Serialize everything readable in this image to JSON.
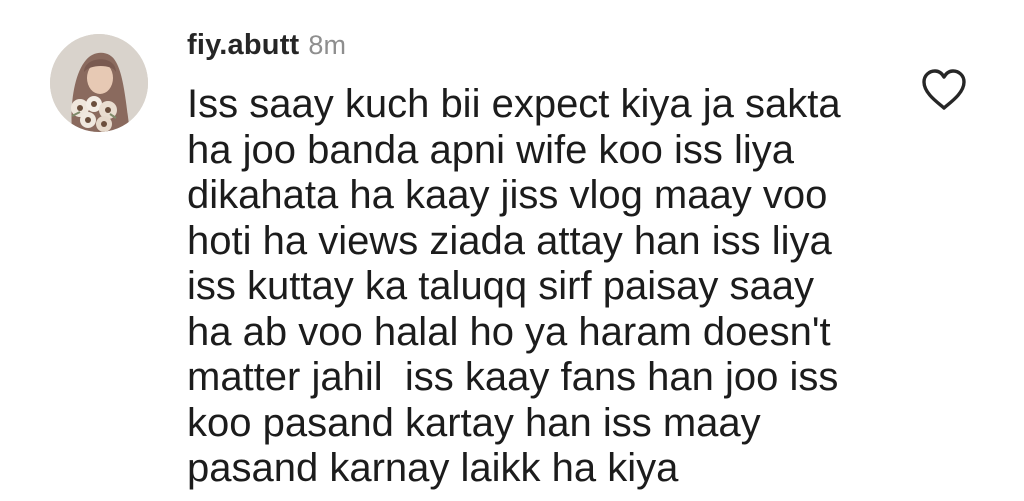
{
  "comment": {
    "username": "fiy.abutt",
    "timestamp": "8m",
    "lines": [
      "Iss saay kuch bii expect kiya ja sakta",
      "ha joo banda apni wife koo iss liya",
      "dikahata ha kaay jiss vlog maay voo",
      "hoti ha views ziada attay han iss liya",
      "iss kuttay ka taluqq sirf paisay saay",
      "ha ab voo halal ho ya haram doesn't",
      "matter jahil  iss kaay fans han joo iss",
      "koo pasand kartay han iss maay",
      "pasand karnay laikk ha kiya"
    ],
    "avatar_icon": "profile-avatar-hijab-flowers",
    "like_icon": "heart-outline-icon"
  },
  "colors": {
    "background": "#ffffff",
    "text": "#1c1c1c",
    "username": "#262626",
    "timestamp": "#8e8e8e",
    "icon_stroke": "#262626"
  }
}
